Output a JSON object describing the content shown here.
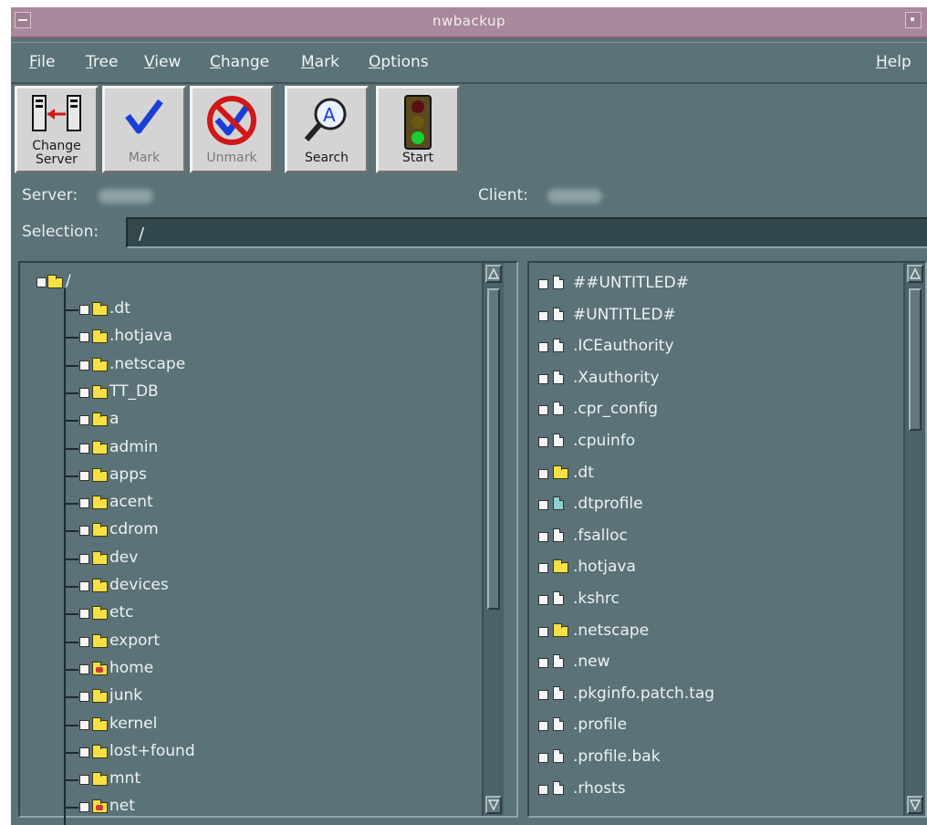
{
  "window": {
    "title": "nwbackup"
  },
  "menu": {
    "items": [
      "File",
      "Tree",
      "View",
      "Change",
      "Mark",
      "Options"
    ],
    "help": "Help"
  },
  "toolbar": {
    "change_server": "Change Server",
    "mark": "Mark",
    "unmark": "Unmark",
    "search": "Search",
    "start": "Start"
  },
  "server_label": "Server:",
  "client_label": "Client:",
  "selection": {
    "label": "Selection:",
    "value": "/"
  },
  "tree": {
    "root": "/",
    "items": [
      {
        "name": ".dt",
        "icon": "folder"
      },
      {
        "name": ".hotjava",
        "icon": "folder"
      },
      {
        "name": ".netscape",
        "icon": "folder"
      },
      {
        "name": "TT_DB",
        "icon": "folder"
      },
      {
        "name": "a",
        "icon": "folder"
      },
      {
        "name": "admin",
        "icon": "folder"
      },
      {
        "name": "apps",
        "icon": "folder"
      },
      {
        "name": "acent",
        "icon": "folder"
      },
      {
        "name": "cdrom",
        "icon": "folder"
      },
      {
        "name": "dev",
        "icon": "folder"
      },
      {
        "name": "devices",
        "icon": "folder"
      },
      {
        "name": "etc",
        "icon": "folder"
      },
      {
        "name": "export",
        "icon": "folder"
      },
      {
        "name": "home",
        "icon": "folder-link"
      },
      {
        "name": "junk",
        "icon": "folder"
      },
      {
        "name": "kernel",
        "icon": "folder"
      },
      {
        "name": "lost+found",
        "icon": "folder"
      },
      {
        "name": "mnt",
        "icon": "folder"
      },
      {
        "name": "net",
        "icon": "folder-link"
      }
    ]
  },
  "files": [
    {
      "name": "##UNTITLED#",
      "icon": "file"
    },
    {
      "name": "#UNTITLED#",
      "icon": "file"
    },
    {
      "name": ".ICEauthority",
      "icon": "file"
    },
    {
      "name": ".Xauthority",
      "icon": "file"
    },
    {
      "name": ".cpr_config",
      "icon": "file"
    },
    {
      "name": ".cpuinfo",
      "icon": "file"
    },
    {
      "name": ".dt",
      "icon": "folder"
    },
    {
      "name": ".dtprofile",
      "icon": "file-teal"
    },
    {
      "name": ".fsalloc",
      "icon": "file"
    },
    {
      "name": ".hotjava",
      "icon": "folder"
    },
    {
      "name": ".kshrc",
      "icon": "file"
    },
    {
      "name": ".netscape",
      "icon": "folder"
    },
    {
      "name": ".new",
      "icon": "file"
    },
    {
      "name": ".pkginfo.patch.tag",
      "icon": "file"
    },
    {
      "name": ".profile",
      "icon": "file"
    },
    {
      "name": ".profile.bak",
      "icon": "file"
    },
    {
      "name": ".rhosts",
      "icon": "file"
    }
  ],
  "colors": {
    "window_bg": "#5a7278",
    "titlebar": "#a8889a",
    "button_face": "#d4d4d4",
    "folder": "#f6e046"
  }
}
